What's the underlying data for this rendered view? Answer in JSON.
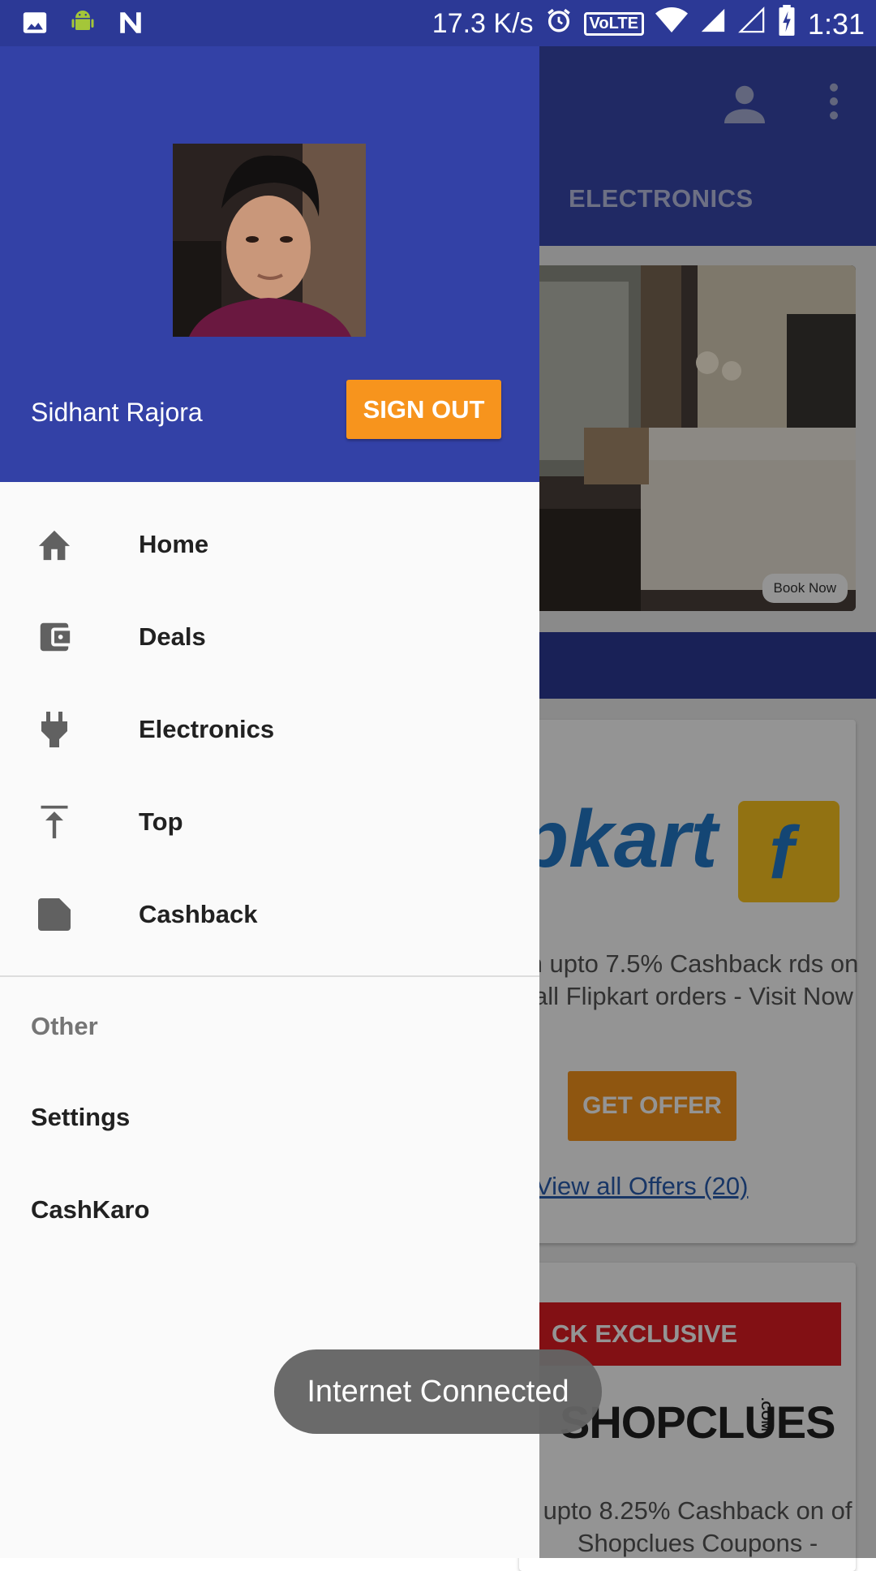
{
  "status_bar": {
    "speed": "17.3 K/s",
    "volte": "VoLTE",
    "time": "1:31"
  },
  "background": {
    "tab_label": "ELECTRONICS",
    "banner_button": "Book Now",
    "offer_card": {
      "brand": "pkart",
      "description": "n upto 7.5% Cashback rds on all Flipkart orders - Visit Now",
      "button": "GET OFFER",
      "link": "View all Offers (20)"
    },
    "second_card": {
      "ribbon": "CK EXCLUSIVE",
      "brand": "SHOPCLUES",
      "brand_suffix": ".COM",
      "description": "upto 8.25% Cashback on of Shopclues Coupons -"
    }
  },
  "drawer": {
    "user_name": "Sidhant Rajora",
    "sign_out": "SIGN OUT",
    "menu": [
      {
        "label": "Home",
        "icon": "home-icon"
      },
      {
        "label": "Deals",
        "icon": "wallet-icon"
      },
      {
        "label": "Electronics",
        "icon": "plug-icon"
      },
      {
        "label": "Top",
        "icon": "vertical-align-top-icon"
      },
      {
        "label": "Cashback",
        "icon": "label-icon"
      }
    ],
    "section_title": "Other",
    "other_items": [
      "Settings",
      "CashKaro"
    ]
  },
  "toast": "Internet Connected",
  "colors": {
    "primary": "#3341a6",
    "accent": "#f7941d",
    "status_bar": "#2c3996"
  }
}
